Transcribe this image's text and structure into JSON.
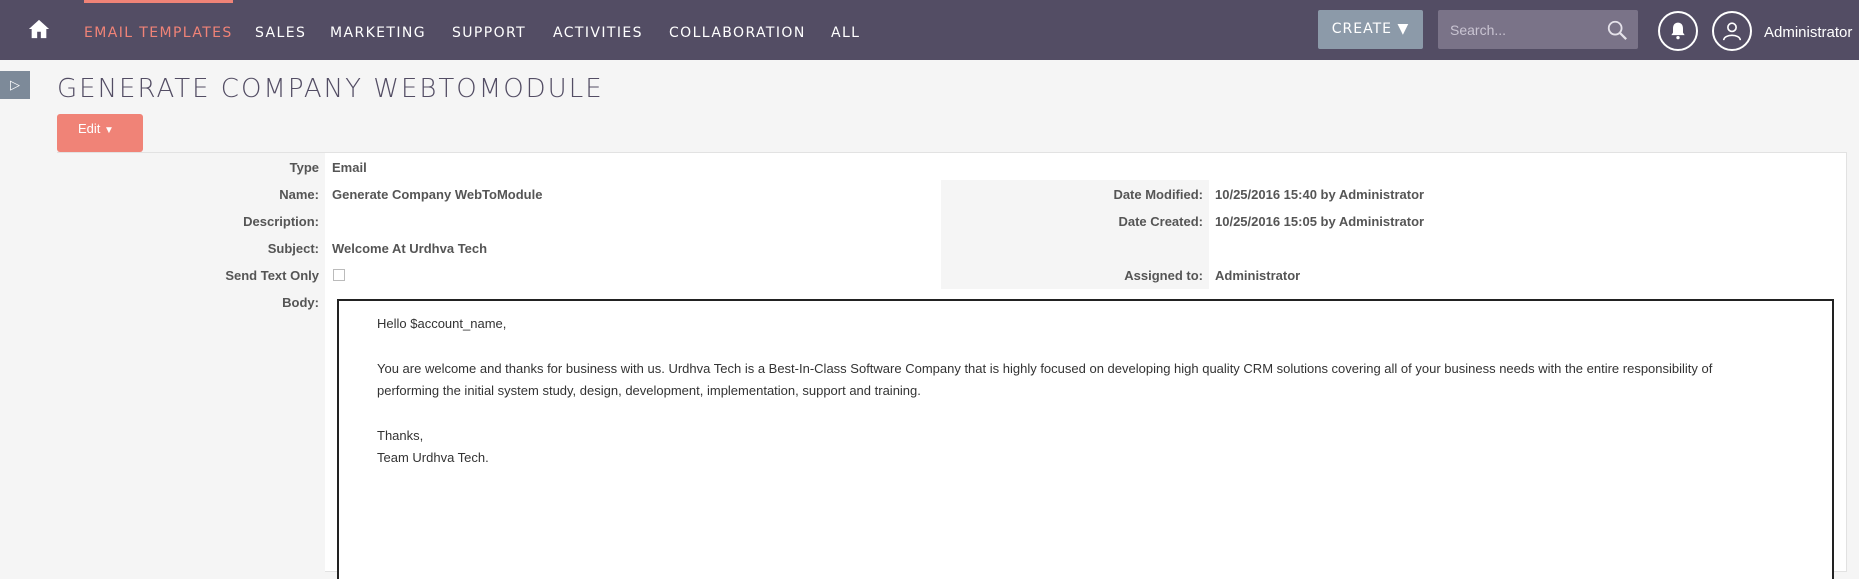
{
  "nav": {
    "items": [
      {
        "label": "EMAIL TEMPLATES",
        "active": true
      },
      {
        "label": "SALES"
      },
      {
        "label": "MARKETING"
      },
      {
        "label": "SUPPORT"
      },
      {
        "label": "ACTIVITIES"
      },
      {
        "label": "COLLABORATION"
      },
      {
        "label": "ALL"
      }
    ],
    "create_label": "CREATE",
    "search_placeholder": "Search...",
    "username": "Administrator"
  },
  "page": {
    "title": "GENERATE COMPANY WEBTOMODULE",
    "edit_label": "Edit"
  },
  "detail": {
    "type_label": "Type",
    "type_value": "Email",
    "name_label": "Name:",
    "name_value": "Generate Company WebToModule",
    "description_label": "Description:",
    "description_value": "",
    "subject_label": "Subject:",
    "subject_value": "Welcome At Urdhva Tech",
    "send_text_only_label": "Send Text Only",
    "send_text_only_checked": false,
    "body_label": "Body:",
    "date_modified_label": "Date Modified:",
    "date_modified_value": "10/25/2016 15:40 by Administrator",
    "date_created_label": "Date Created:",
    "date_created_value": "10/25/2016 15:05 by Administrator",
    "assigned_to_label": "Assigned to:",
    "assigned_to_value": "Administrator"
  },
  "body": {
    "greeting": "Hello $account_name,",
    "paragraph": "You are welcome and thanks for business with us. Urdhva Tech is a Best-In-Class Software Company that is highly focused on developing high quality CRM solutions covering all of your business needs with the entire responsibility of performing the initial system study, design, development, implementation, support and training.",
    "closing": "Thanks,",
    "signature": "Team Urdhva Tech."
  }
}
